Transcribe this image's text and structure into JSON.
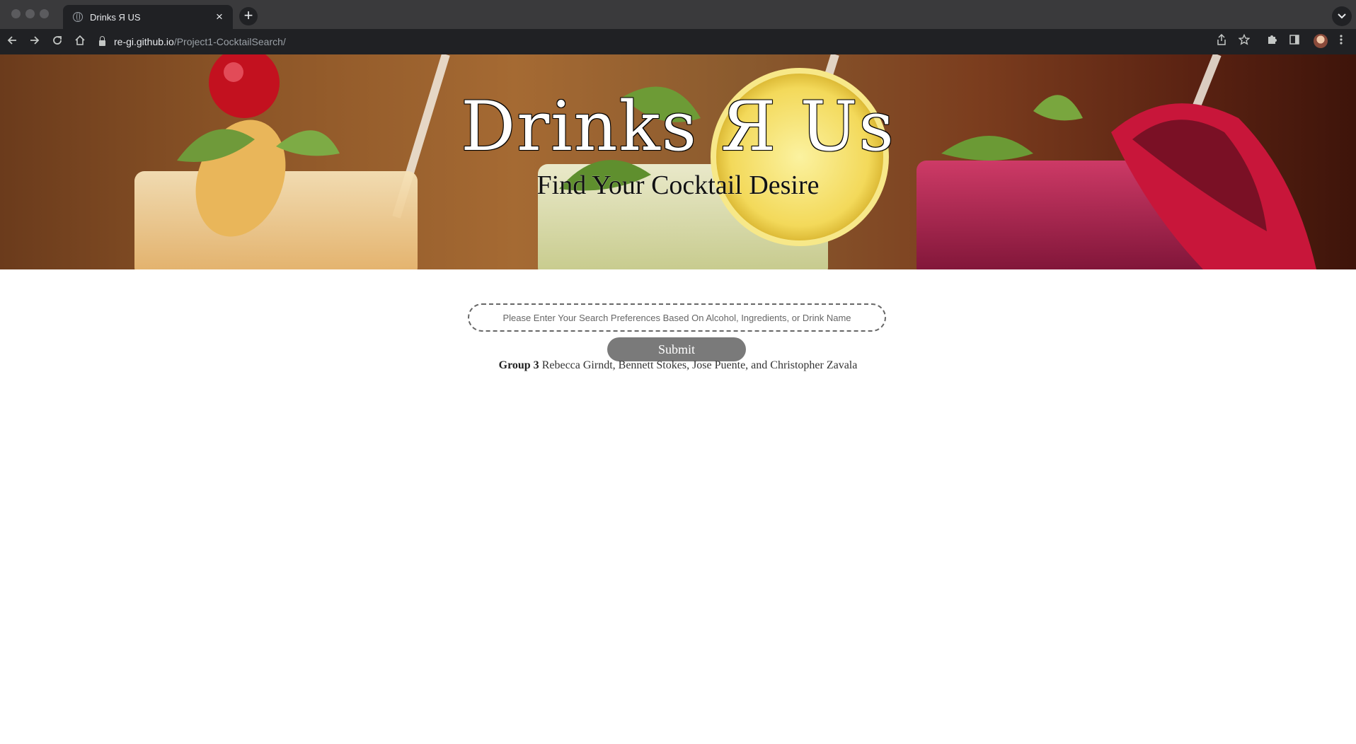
{
  "browser": {
    "tab_title": "Drinks Я US",
    "url_host": "re-gi.github.io",
    "url_path": "/Project1-CocktailSearch/",
    "new_tab_symbol": "+",
    "close_symbol": "×"
  },
  "hero": {
    "title": "Drinks Я Us",
    "subtitle": "Find Your Cocktail Desire"
  },
  "search": {
    "placeholder": "Please Enter Your Search Preferences Based On Alcohol, Ingredients, or Drink Name",
    "submit_label": "Submit"
  },
  "footer": {
    "group_label": "Group 3",
    "members": "Rebecca Girndt, Bennett Stokes, Jose Puente, and Christopher Zavala"
  }
}
